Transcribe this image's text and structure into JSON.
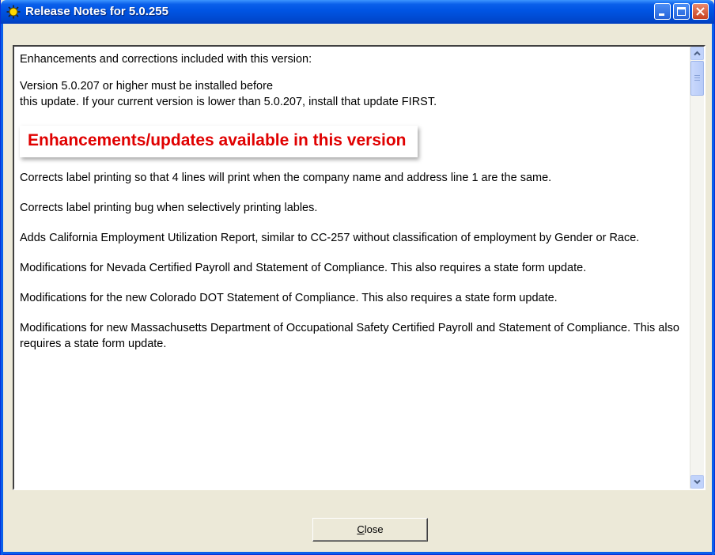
{
  "window": {
    "title": "Release Notes for 5.0.255"
  },
  "notes": {
    "intro": "Enhancements and corrections included with this version:",
    "req_line1": "Version 5.0.207 or higher must be installed before",
    "req_line2": "this update.  If your current version is lower than 5.0.207, install that update FIRST.",
    "banner": "Enhancements/updates available in this version",
    "items": [
      "Corrects label printing so that 4 lines will print when the company name and address line 1 are the same.",
      "Corrects label printing bug when selectively printing lables.",
      "Adds California Employment Utilization Report, similar to CC-257 without classification of employment by Gender or Race.",
      "Modifications for Nevada Certified Payroll and Statement of Compliance.  This also requires a state form update.",
      "Modifications for the new Colorado DOT Statement of Compliance.  This also requires a state form update.",
      "Modifications for new Massachusetts Department of Occupational Safety Certified Payroll and Statement of Compliance.  This also requires a state form update."
    ]
  },
  "buttons": {
    "close_mnemonic": "C",
    "close_rest": "lose"
  },
  "icons": {
    "app": "sun-icon",
    "minimize": "minimize-icon",
    "maximize": "maximize-icon",
    "close": "close-icon",
    "scroll_up": "chevron-up-icon",
    "scroll_down": "chevron-down-icon"
  },
  "colors": {
    "titlebar": "#0054e3",
    "banner_text": "#e00000",
    "window_bg": "#ece9d8"
  }
}
